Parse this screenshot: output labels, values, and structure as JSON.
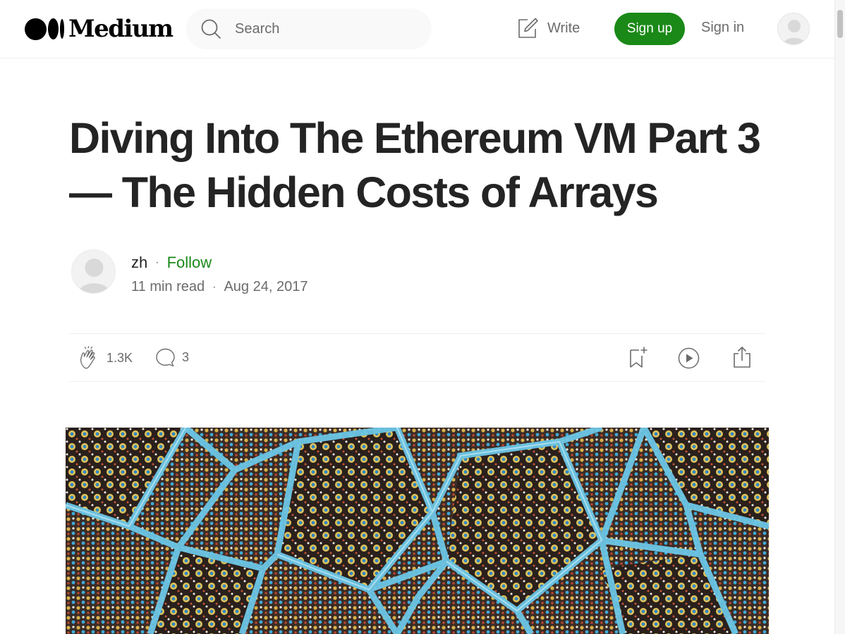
{
  "brand": {
    "name": "Medium"
  },
  "nav": {
    "search_placeholder": "Search",
    "write_label": "Write",
    "signup_label": "Sign up",
    "signin_label": "Sign in"
  },
  "article": {
    "title": "Diving Into The Ethereum VM Part 3 — The Hidden Costs of Arrays",
    "author": "zh",
    "follow_label": "Follow",
    "separator": "·",
    "read_time": "11 min read",
    "date": "Aug 24, 2017",
    "claps": "1.3K",
    "responses": "3"
  },
  "colors": {
    "accent_green": "#1a8917",
    "text_primary": "#242424",
    "text_secondary": "#6b6b6b"
  },
  "icons": {
    "search": "search-icon",
    "write": "write-icon",
    "clap": "clap-icon",
    "comment": "comment-icon",
    "bookmark": "bookmark-add-icon",
    "listen": "play-icon",
    "share": "share-icon"
  }
}
